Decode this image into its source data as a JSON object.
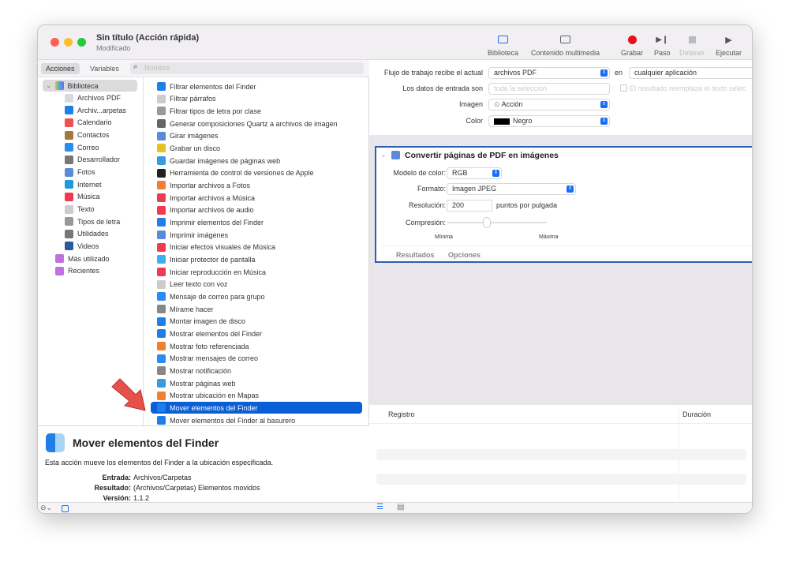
{
  "window": {
    "title": "Sin título (Acción rápida)",
    "subtitle": "Modificado"
  },
  "toolbar": {
    "biblioteca": "Biblioteca",
    "multimedia": "Contenido multimedia",
    "grabar": "Grabar",
    "paso": "Paso",
    "detener": "Detener",
    "ejecutar": "Ejecutar"
  },
  "tabs": {
    "acciones": "Acciones",
    "variables": "Variables"
  },
  "search": {
    "placeholder": "Nombre"
  },
  "library": {
    "root": "Biblioteca",
    "items": [
      {
        "label": "Archivos PDF",
        "color": "#d8d8e0",
        "icon": "pdf-icon"
      },
      {
        "label": "Archiv...arpetas",
        "color": "#1f7fe8",
        "icon": "finder-icon"
      },
      {
        "label": "Calendario",
        "color": "#f05050",
        "icon": "calendar-icon"
      },
      {
        "label": "Contactos",
        "color": "#a07840",
        "icon": "contacts-icon"
      },
      {
        "label": "Correo",
        "color": "#2a8cf0",
        "icon": "mail-icon"
      },
      {
        "label": "Desarrollador",
        "color": "#777",
        "icon": "developer-icon"
      },
      {
        "label": "Fotos",
        "color": "#5a8ad8",
        "icon": "photos-icon"
      },
      {
        "label": "Internet",
        "color": "#1f9ad8",
        "icon": "internet-icon"
      },
      {
        "label": "Música",
        "color": "#f03a50",
        "icon": "music-icon"
      },
      {
        "label": "Texto",
        "color": "#ccc",
        "icon": "text-icon"
      },
      {
        "label": "Tipos de letra",
        "color": "#999",
        "icon": "fonts-icon"
      },
      {
        "label": "Utilidades",
        "color": "#777",
        "icon": "utilities-icon"
      },
      {
        "label": "Videos",
        "color": "#2a5a9a",
        "icon": "video-icon"
      }
    ],
    "extra": [
      {
        "label": "Más utilizado"
      },
      {
        "label": "Recientes"
      }
    ]
  },
  "actions": {
    "selected": "Mover elementos del Finder",
    "items": [
      {
        "label": "Filtrar elementos del Finder",
        "color": "#1f7fe8"
      },
      {
        "label": "Filtrar párrafos",
        "color": "#ccc"
      },
      {
        "label": "Filtrar tipos de letra por clase",
        "color": "#999"
      },
      {
        "label": "Generar composiciones Quartz a archivos de imagen",
        "color": "#666"
      },
      {
        "label": "Girar imágenes",
        "color": "#5a8ad8"
      },
      {
        "label": "Grabar un disco",
        "color": "#e8c020"
      },
      {
        "label": "Guardar imágenes de páginas web",
        "color": "#3a9ae0"
      },
      {
        "label": "Herramienta de control de versiones de Apple",
        "color": "#222"
      },
      {
        "label": "Importar archivos a Fotos",
        "color": "#f08030"
      },
      {
        "label": "Importar archivos a Música",
        "color": "#f03a50"
      },
      {
        "label": "Importar archivos de audio",
        "color": "#f03a50"
      },
      {
        "label": "Imprimir elementos del Finder",
        "color": "#1f7fe8"
      },
      {
        "label": "Imprimir imágenes",
        "color": "#5a8ad8"
      },
      {
        "label": "Iniciar efectos visuales de Música",
        "color": "#f03a50"
      },
      {
        "label": "Iniciar protector de pantalla",
        "color": "#3ab0f0"
      },
      {
        "label": "Iniciar reproducción en Música",
        "color": "#f03a50"
      },
      {
        "label": "Leer texto con voz",
        "color": "#ccc"
      },
      {
        "label": "Mensaje de correo para grupo",
        "color": "#2a8cf0"
      },
      {
        "label": "Mírame hacer",
        "color": "#888"
      },
      {
        "label": "Montar imagen de disco",
        "color": "#1f7fe8"
      },
      {
        "label": "Mostrar elementos del Finder",
        "color": "#1f7fe8"
      },
      {
        "label": "Mostrar foto referenciada",
        "color": "#f08030"
      },
      {
        "label": "Mostrar mensajes de correo",
        "color": "#2a8cf0"
      },
      {
        "label": "Mostrar notificación",
        "color": "#888"
      },
      {
        "label": "Mostrar páginas web",
        "color": "#3a9ae0"
      },
      {
        "label": "Mostrar ubicación en Mapas",
        "color": "#f08030"
      },
      {
        "label": "Mover elementos del Finder",
        "color": "#1f7fe8"
      },
      {
        "label": "Mover elementos del Finder al basurero",
        "color": "#1f7fe8"
      }
    ]
  },
  "description": {
    "title": "Mover elementos del Finder",
    "text": "Esta acción mueve los elementos del Finder a la ubicación especificada.",
    "entrada_label": "Entrada:",
    "entrada": "Archivos/Carpetas",
    "resultado_label": "Resultado:",
    "resultado": "(Archivos/Carpetas) Elementos movidos",
    "version_label": "Versión:",
    "version": "1.1.2"
  },
  "workflow": {
    "recibe_label": "Flujo de trabajo recibe el actual",
    "recibe": "archivos PDF",
    "en_label": "en",
    "app": "cualquier aplicación",
    "datos_label": "Los datos de entrada son",
    "datos": "toda la selección",
    "reemplaza": "El resultado reemplaza el texto selec",
    "imagen_label": "Imagen",
    "imagen": "Acción",
    "color_label": "Color",
    "color": "Negro"
  },
  "action_box": {
    "title": "Convertir páginas de PDF en imágenes",
    "modelo_label": "Modelo de color:",
    "modelo": "RGB",
    "formato_label": "Formato:",
    "formato": "Imagen JPEG",
    "resolucion_label": "Resolución:",
    "resolucion": "200",
    "resolucion_unit": "puntos por pulgada",
    "compresion_label": "Compresión:",
    "compresion_value": 0.4,
    "min": "Mínima",
    "max": "Máxima",
    "tab_resultados": "Resultados",
    "tab_opciones": "Opciones"
  },
  "log": {
    "col_registro": "Registro",
    "col_duracion": "Duración"
  },
  "colors": {
    "accent": "#0a5fd6",
    "record": "#e8101a",
    "box_border": "#2f5eb5"
  }
}
